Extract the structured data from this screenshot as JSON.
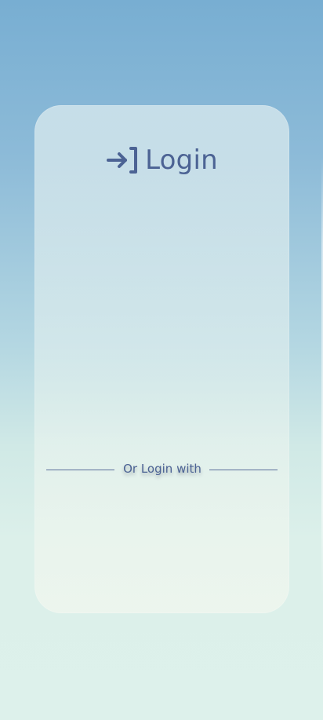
{
  "login": {
    "title": "Login",
    "title_icon": "login-arrow-bracket-icon",
    "divider_text": "Or Login with"
  },
  "colors": {
    "accent": "#4c6394",
    "line": "#5c6f9b",
    "background_top": "#78aed2",
    "background_bottom": "#ddf1eb"
  }
}
